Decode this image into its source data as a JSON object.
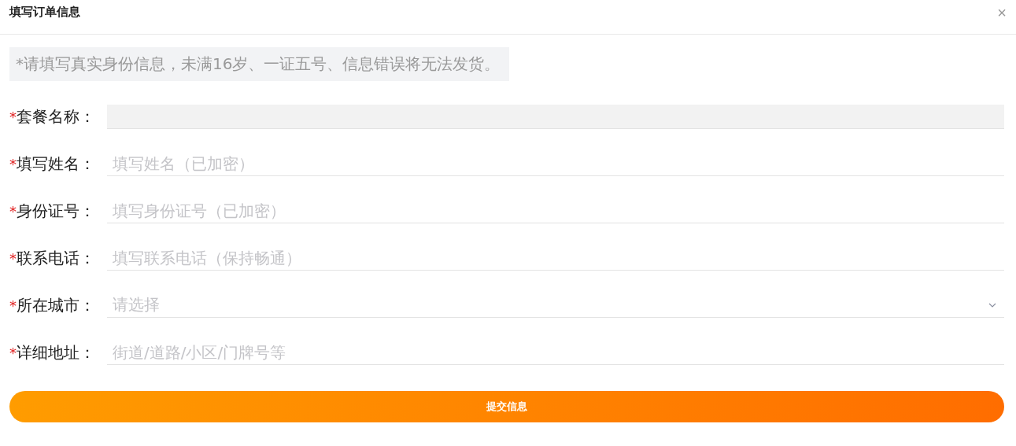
{
  "window": {
    "title": "填写订单信息",
    "close": "×"
  },
  "notice": "*请填写真实身份信息，未满16岁、一证五号、信息错误将无法发货。",
  "fields": [
    {
      "kind": "readonly",
      "mark": "*",
      "label": "套餐名称："
    },
    {
      "kind": "text",
      "mark": "*",
      "label": "填写姓名：",
      "placeholder": "填写姓名（已加密）"
    },
    {
      "kind": "text",
      "mark": "*",
      "label": "身份证号：",
      "placeholder": "填写身份证号（已加密）"
    },
    {
      "kind": "text",
      "mark": "*",
      "label": "联系电话：",
      "placeholder": "填写联系电话（保持畅通）"
    },
    {
      "kind": "select",
      "mark": "*",
      "label": "所在城市：",
      "placeholder": "请选择"
    },
    {
      "kind": "text",
      "mark": "*",
      "label": "详细地址：",
      "placeholder": "街道/道路/小区/门牌号等"
    }
  ],
  "submit": "提交信息"
}
